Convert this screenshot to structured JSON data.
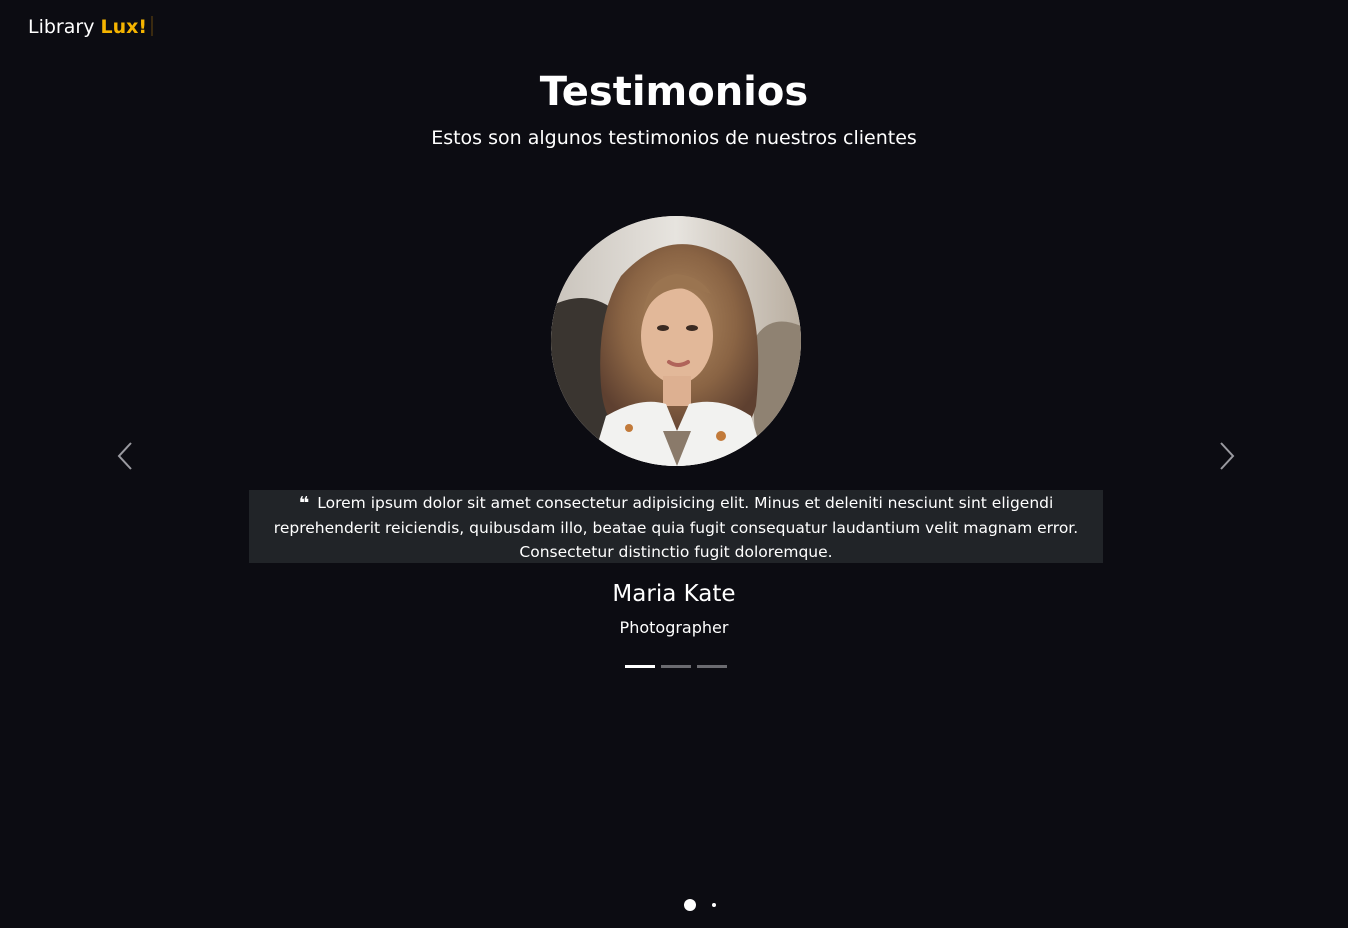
{
  "brand": {
    "name": "Library",
    "accent": "Lux!"
  },
  "section": {
    "title": "Testimonios",
    "subtitle": "Estos son algunos testimonios de nuestros clientes"
  },
  "testimonial": {
    "quote_icon": "quote-left-icon",
    "quote": "Lorem ipsum dolor sit amet consectetur adipisicing elit. Minus et deleniti nesciunt sint eligendi reprehenderit reiciendis, quibusdam illo, beatae quia fugit consequatur laudantium velit magnam error. Consectetur distinctio fugit doloremque.",
    "name": "Maria Kate",
    "role": "Photographer"
  },
  "carousel": {
    "prev_icon": "chevron-left-icon",
    "next_icon": "chevron-right-icon",
    "indicators_total": 3,
    "active_index": 0
  },
  "pager": {
    "total": 2,
    "active_index": 0
  },
  "colors": {
    "background": "#0c0c12",
    "accent": "#f5b400",
    "quote_box": "#212428",
    "indicator_inactive": "#6b6b70",
    "text": "#ffffff"
  }
}
